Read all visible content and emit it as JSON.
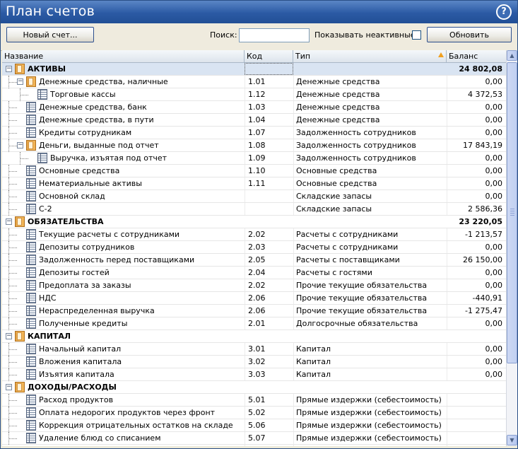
{
  "window": {
    "title": "План счетов",
    "help_icon": "help-icon"
  },
  "toolbar": {
    "new_account_label": "Новый счет...",
    "search_label": "Поиск:",
    "search_value": "",
    "show_inactive_label": "Показывать неактивные:",
    "show_inactive_checked": false,
    "refresh_label": "Обновить"
  },
  "columns": {
    "name": "Название",
    "code": "Код",
    "type": "Тип",
    "balance": "Баланс"
  },
  "rows": [
    {
      "name": "АКТИВЫ",
      "code": "",
      "type": "",
      "balance": "24 802,08",
      "level": 0,
      "kind": "group",
      "icon": "folder-icon",
      "expanded": true
    },
    {
      "name": "Денежные средства, наличные",
      "code": "1.01",
      "type": "Денежные средства",
      "balance": "0,00",
      "level": 1,
      "kind": "folder",
      "icon": "folder-icon",
      "expanded": true
    },
    {
      "name": "Торговые кассы",
      "code": "1.12",
      "type": "Денежные средства",
      "balance": "4 372,53",
      "level": 2,
      "kind": "leaf",
      "icon": "ledger-icon"
    },
    {
      "name": "Денежные средства, банк",
      "code": "1.03",
      "type": "Денежные средства",
      "balance": "0,00",
      "level": 1,
      "kind": "leaf",
      "icon": "ledger-icon"
    },
    {
      "name": "Денежные средства, в пути",
      "code": "1.04",
      "type": "Денежные средства",
      "balance": "0,00",
      "level": 1,
      "kind": "leaf",
      "icon": "ledger-icon"
    },
    {
      "name": "Кредиты сотрудникам",
      "code": "1.07",
      "type": "Задолженность сотрудников",
      "balance": "0,00",
      "level": 1,
      "kind": "leaf",
      "icon": "ledger-icon"
    },
    {
      "name": "Деньги, выданные под отчет",
      "code": "1.08",
      "type": "Задолженность сотрудников",
      "balance": "17 843,19",
      "level": 1,
      "kind": "folder",
      "icon": "folder-icon",
      "expanded": true
    },
    {
      "name": "Выручка, изъятая под отчет",
      "code": "1.09",
      "type": "Задолженность сотрудников",
      "balance": "0,00",
      "level": 2,
      "kind": "leaf",
      "icon": "ledger-icon"
    },
    {
      "name": "Основные средства",
      "code": "1.10",
      "type": "Основные средства",
      "balance": "0,00",
      "level": 1,
      "kind": "leaf",
      "icon": "ledger-icon"
    },
    {
      "name": "Нематериальные активы",
      "code": "1.11",
      "type": "Основные средства",
      "balance": "0,00",
      "level": 1,
      "kind": "leaf",
      "icon": "ledger-icon"
    },
    {
      "name": "Основной склад",
      "code": "",
      "type": "Складские запасы",
      "balance": "0,00",
      "level": 1,
      "kind": "leaf",
      "icon": "ledger-icon"
    },
    {
      "name": "С-2",
      "code": "",
      "type": "Складские запасы",
      "balance": "2 586,36",
      "level": 1,
      "kind": "leaf",
      "icon": "ledger-icon"
    },
    {
      "name": "ОБЯЗАТЕЛЬСТВА",
      "code": "",
      "type": "",
      "balance": "23 220,05",
      "level": 0,
      "kind": "group",
      "icon": "folder-icon",
      "expanded": true
    },
    {
      "name": "Текущие расчеты с сотрудниками",
      "code": "2.02",
      "type": "Расчеты с сотрудниками",
      "balance": "-1 213,57",
      "level": 1,
      "kind": "leaf",
      "icon": "ledger-icon"
    },
    {
      "name": "Депозиты сотрудников",
      "code": "2.03",
      "type": "Расчеты с сотрудниками",
      "balance": "0,00",
      "level": 1,
      "kind": "leaf",
      "icon": "ledger-icon"
    },
    {
      "name": "Задолженность перед поставщиками",
      "code": "2.05",
      "type": "Расчеты с поставщиками",
      "balance": "26 150,00",
      "level": 1,
      "kind": "leaf",
      "icon": "ledger-icon"
    },
    {
      "name": "Депозиты гостей",
      "code": "2.04",
      "type": "Расчеты с гостями",
      "balance": "0,00",
      "level": 1,
      "kind": "leaf",
      "icon": "ledger-icon"
    },
    {
      "name": "Предоплата за заказы",
      "code": "2.02",
      "type": "Прочие текущие обязательства",
      "balance": "0,00",
      "level": 1,
      "kind": "leaf",
      "icon": "ledger-icon"
    },
    {
      "name": "НДС",
      "code": "2.06",
      "type": "Прочие текущие обязательства",
      "balance": "-440,91",
      "level": 1,
      "kind": "leaf",
      "icon": "ledger-icon"
    },
    {
      "name": "Нераспределенная выручка",
      "code": "2.06",
      "type": "Прочие текущие обязательства",
      "balance": "-1 275,47",
      "level": 1,
      "kind": "leaf",
      "icon": "ledger-icon"
    },
    {
      "name": "Полученные кредиты",
      "code": "2.01",
      "type": "Долгосрочные обязательства",
      "balance": "0,00",
      "level": 1,
      "kind": "leaf",
      "icon": "ledger-icon"
    },
    {
      "name": "КАПИТАЛ",
      "code": "",
      "type": "",
      "balance": "",
      "level": 0,
      "kind": "group",
      "icon": "folder-icon",
      "expanded": true
    },
    {
      "name": "Начальный капитал",
      "code": "3.01",
      "type": "Капитал",
      "balance": "0,00",
      "level": 1,
      "kind": "leaf",
      "icon": "ledger-icon"
    },
    {
      "name": "Вложения капитала",
      "code": "3.02",
      "type": "Капитал",
      "balance": "0,00",
      "level": 1,
      "kind": "leaf",
      "icon": "ledger-icon"
    },
    {
      "name": "Изъятия капитала",
      "code": "3.03",
      "type": "Капитал",
      "balance": "0,00",
      "level": 1,
      "kind": "leaf",
      "icon": "ledger-icon"
    },
    {
      "name": "ДОХОДЫ/РАСХОДЫ",
      "code": "",
      "type": "",
      "balance": "",
      "level": 0,
      "kind": "group",
      "icon": "folder-icon",
      "expanded": true
    },
    {
      "name": "Расход продуктов",
      "code": "5.01",
      "type": "Прямые издержки (себестоимость)",
      "balance": "",
      "level": 1,
      "kind": "leaf",
      "icon": "ledger-icon"
    },
    {
      "name": "Оплата недорогих продуктов через фронт",
      "code": "5.02",
      "type": "Прямые издержки (себестоимость)",
      "balance": "",
      "level": 1,
      "kind": "leaf",
      "icon": "ledger-icon"
    },
    {
      "name": "Коррекция отрицательных остатков на складе",
      "code": "5.06",
      "type": "Прямые издержки (себестоимость)",
      "balance": "",
      "level": 1,
      "kind": "leaf",
      "icon": "ledger-icon"
    },
    {
      "name": "Удаление блюд со списанием",
      "code": "5.07",
      "type": "Прямые издержки (себестоимость)",
      "balance": "",
      "level": 1,
      "kind": "leaf",
      "icon": "ledger-icon"
    }
  ]
}
